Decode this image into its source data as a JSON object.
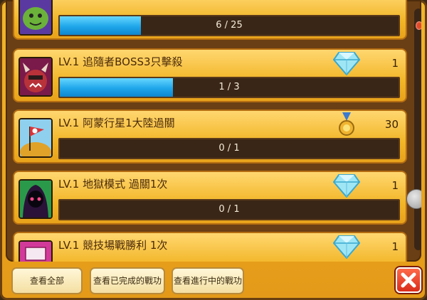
{
  "achievements": [
    {
      "title": "",
      "reward_value": "",
      "progress_text": "6 / 25",
      "progress": 0.24,
      "reward_icon": "none",
      "portrait_icon": "green-monster-icon"
    },
    {
      "title": "LV.1 追隨者BOSS3只擊殺",
      "reward_value": "1",
      "progress_text": "1 / 3",
      "progress": 0.333,
      "reward_icon": "diamond-icon",
      "portrait_icon": "horned-boss-icon"
    },
    {
      "title": "LV.1 阿蒙行星1大陸過關",
      "reward_value": "30",
      "progress_text": "0 / 1",
      "progress": 0,
      "reward_icon": "medal-icon",
      "portrait_icon": "flag-planet-icon"
    },
    {
      "title": "LV.1 地獄模式 過關1次",
      "reward_value": "1",
      "progress_text": "0 / 1",
      "progress": 0,
      "reward_icon": "diamond-icon",
      "portrait_icon": "hooded-figure-icon"
    },
    {
      "title": "LV.1 競技場戰勝利 1次",
      "reward_value": "1",
      "progress_text": "",
      "progress": 0,
      "reward_icon": "diamond-icon",
      "portrait_icon": "arena-icon"
    }
  ],
  "buttons": {
    "view_all": "查看全部",
    "view_completed": "查看已完成的戰功",
    "view_in_progress": "查看進行中的戰功"
  },
  "colors": {
    "bar_fill": "#1fa6ea",
    "card": "#f2b628",
    "close": "#d92c1c"
  }
}
